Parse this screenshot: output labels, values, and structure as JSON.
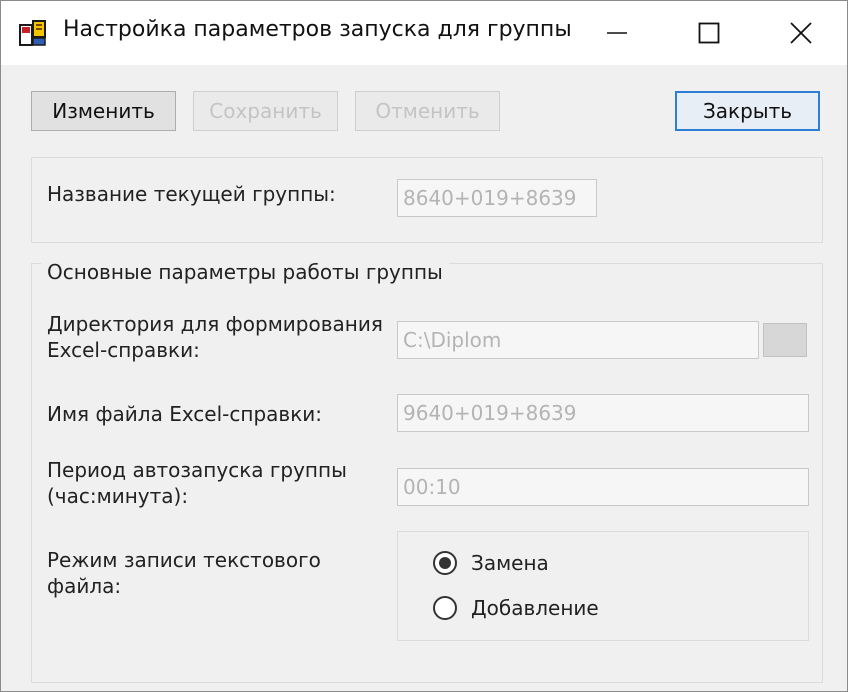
{
  "window": {
    "title": "Настройка параметров запуска для группы"
  },
  "toolbar": {
    "edit_label": "Изменить",
    "save_label": "Сохранить",
    "cancel_label": "Отменить",
    "close_label": "Закрыть"
  },
  "group": {
    "current_name_label": "Название текущей группы:",
    "current_name_value": "8640+019+8639"
  },
  "params": {
    "section_title": "Основные параметры работы группы",
    "dir_label_line1": "Директория для формирования",
    "dir_label_line2": "Excel-справки:",
    "dir_value": "C:\\Diplom",
    "filename_label": "Имя файла Excel-справки:",
    "filename_value": "9640+019+8639",
    "period_label_line1": "Период автозапуска группы",
    "period_label_line2": "(час:минута):",
    "period_value": "00:10",
    "mode_label_line1": "Режим записи текстового",
    "mode_label_line2": "файла:",
    "mode_options": [
      {
        "label": "Замена",
        "checked": true
      },
      {
        "label": "Добавление",
        "checked": false
      }
    ]
  },
  "icons": {
    "app": "app-icon",
    "minimize": "minimize-icon",
    "maximize": "maximize-icon",
    "close": "close-icon",
    "browse": "folder-browse-icon"
  },
  "colors": {
    "focus_border": "#2c7fd4",
    "disabled_text": "#c4c4c4",
    "window_bg": "#f0f0f0"
  }
}
